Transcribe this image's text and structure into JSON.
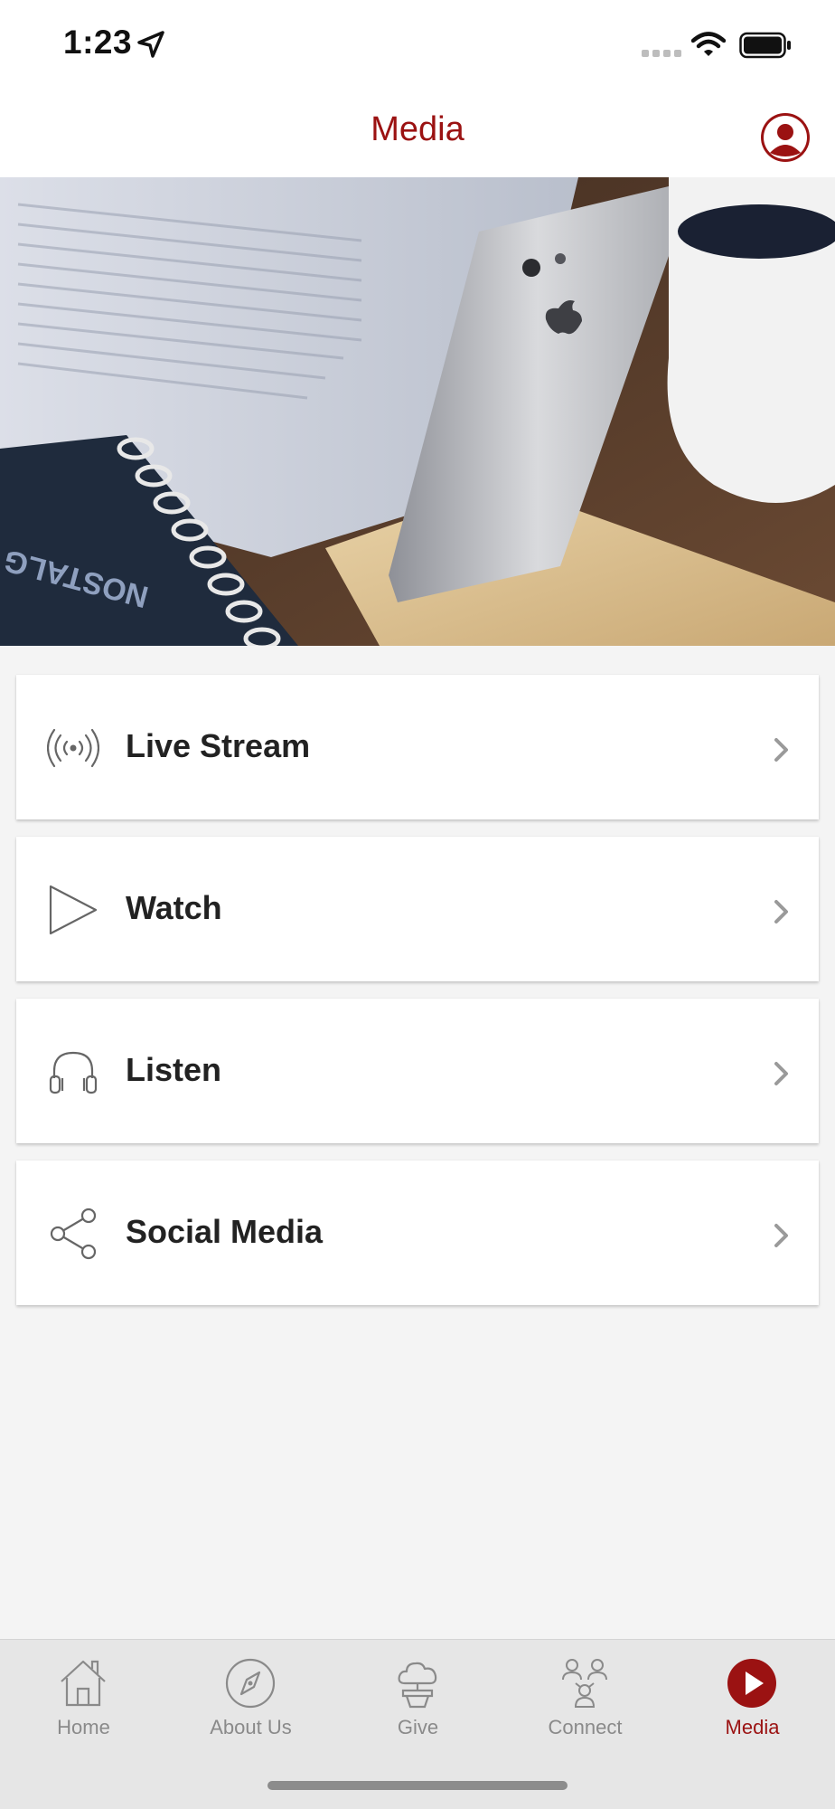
{
  "status_bar": {
    "time": "1:23"
  },
  "header": {
    "title": "Media"
  },
  "hero": {
    "cover_text": "NOSTALG UP IN H"
  },
  "menu": {
    "items": [
      {
        "label": "Live Stream",
        "icon": "broadcast-icon"
      },
      {
        "label": "Watch",
        "icon": "play-icon"
      },
      {
        "label": "Listen",
        "icon": "headphones-icon"
      },
      {
        "label": "Social Media",
        "icon": "share-icon"
      }
    ]
  },
  "tabs": [
    {
      "label": "Home",
      "icon": "home-icon",
      "active": false
    },
    {
      "label": "About Us",
      "icon": "compass-icon",
      "active": false
    },
    {
      "label": "Give",
      "icon": "give-icon",
      "active": false
    },
    {
      "label": "Connect",
      "icon": "people-icon",
      "active": false
    },
    {
      "label": "Media",
      "icon": "play-circle-icon",
      "active": true
    }
  ],
  "colors": {
    "accent": "#9b1212",
    "background": "#f4f4f4",
    "inactive_tab": "#8a8a8a"
  }
}
